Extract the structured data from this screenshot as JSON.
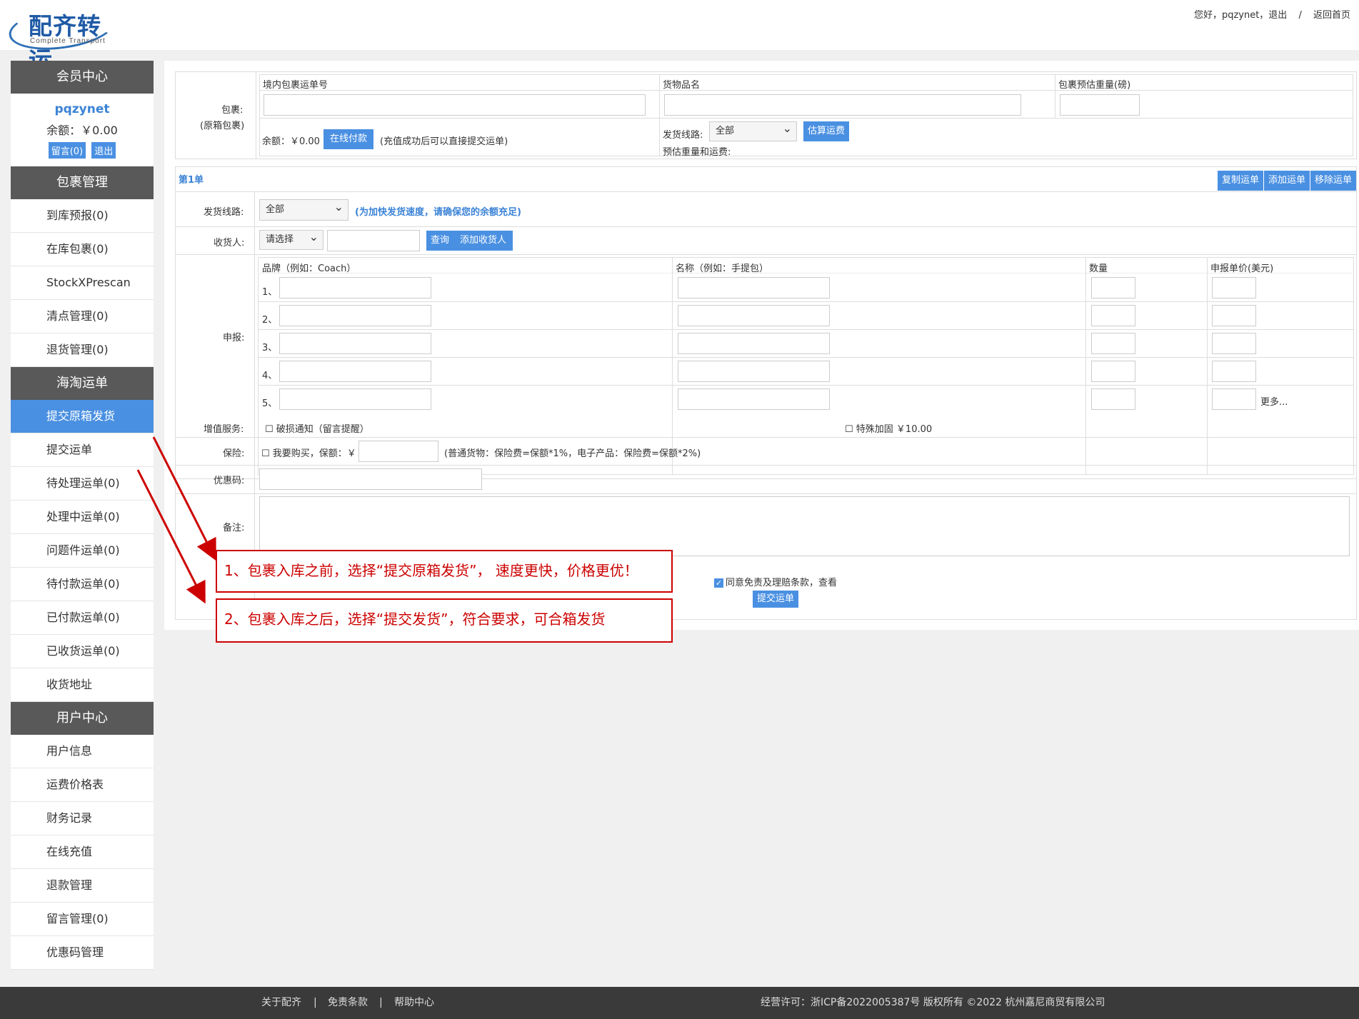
{
  "header": {
    "logo_text": "配齐转运",
    "logo_sub": "Complete Transport",
    "greeting": "您好，pqzynet，",
    "logout": "退出",
    "sep": "/",
    "home": "返回首页"
  },
  "sidebar": {
    "member_title": "会员中心",
    "username": "pqzynet",
    "balance": "余额：￥0.00",
    "msg_btn": "留言(0)",
    "logout_btn": "退出",
    "group1_title": "包裹管理",
    "group1_items": [
      "到库预报(0)",
      "在库包裹(0)",
      "StockXPrescan",
      "清点管理(0)",
      "退货管理(0)"
    ],
    "group2_title": "海淘运单",
    "group2_items": [
      "提交原箱发货",
      "提交运单",
      "待处理运单(0)",
      "处理中运单(0)",
      "问题件运单(0)",
      "待付款运单(0)",
      "已付款运单(0)",
      "已收货运单(0)",
      "收货地址"
    ],
    "group3_title": "用户中心",
    "group3_items": [
      "用户信息",
      "运费价格表",
      "财务记录",
      "在线充值",
      "退款管理",
      "留言管理(0)",
      "优惠码管理"
    ]
  },
  "package": {
    "label1": "包裹:",
    "label2": "(原箱包裹)",
    "col_tracking": "境内包裹运单号",
    "col_goods": "货物品名",
    "col_weight": "包裹预估重量(磅)",
    "balance": "余额：￥0.00",
    "pay_btn": "在线付款",
    "pay_note": "(充值成功后可以直接提交运单)",
    "route_label": "发货线路:",
    "route_value": "全部",
    "estimate_btn": "估算运费",
    "estimate_label": "预估重量和运费:"
  },
  "order": {
    "title": "第1单",
    "copy_btn": "复制运单",
    "add_btn": "添加运单",
    "remove_btn": "移除运单",
    "route_label": "发货线路:",
    "route_value": "全部",
    "route_note": "(为加快发货速度，请确保您的余额充足)",
    "receiver_label": "收货人:",
    "receiver_select": "请选择",
    "query_btn": "查询",
    "add_receiver_btn": "添加收货人",
    "declare_label": "申报:",
    "col_brand": "品牌（例如：Coach）",
    "col_name": "名称（例如：手提包）",
    "col_qty": "数量",
    "col_price": "申报单价(美元)",
    "rows": [
      "1、",
      "2、",
      "3、",
      "4、",
      "5、"
    ],
    "more": "更多...",
    "vas_label": "增值服务:",
    "vas_opt1": "破损通知（留言提醒）",
    "vas_opt2": "特殊加固 ￥10.00",
    "ins_label": "保险:",
    "ins_opt": "我要购买，保额：￥",
    "ins_note": "(普通货物：保险费=保额*1%，电子产品：保险费=保额*2%)",
    "coupon_label": "优惠码:",
    "remark_label": "备注:"
  },
  "submit": {
    "agree": "同意免责及理赔条款，查看",
    "submit_btn": "提交运单"
  },
  "annotations": {
    "note1": "1、包裹入库之前，选择“提交原箱发货”， 速度更快，价格更优！",
    "note2": "2、包裹入库之后，选择“提交发货”，符合要求，可合箱发货"
  },
  "footer": {
    "about": "关于配齐",
    "disclaimer": "免责条款",
    "help": "帮助中心",
    "sep": "|",
    "license": "经营许可：浙ICP备2022005387号 版权所有 ©2022 杭州嘉尼商贸有限公司"
  },
  "colors": {
    "accent": "#4a90e2",
    "sidebar_head": "#595959",
    "annotation": "#cc0000",
    "footer": "#3a3a3a"
  }
}
